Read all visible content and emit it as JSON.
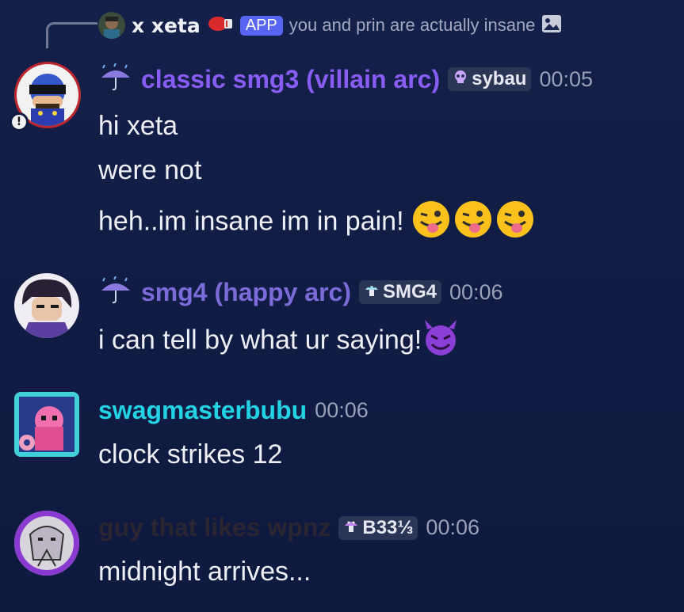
{
  "reply": {
    "name": "x xeta",
    "badge": "APP",
    "text": "you and prin are actually insane"
  },
  "messages": [
    {
      "username": "classic smg3 (villain arc)",
      "username_color": "#8a5cf6",
      "tag": "sybau",
      "time": "00:05",
      "lines": [
        "hi xeta",
        "were not",
        "heh..im insane im in pain!"
      ]
    },
    {
      "username": "smg4 (happy arc)",
      "username_color": "#7b6ad8",
      "tag": "SMG4",
      "time": "00:06",
      "lines": [
        "i can tell by what ur saying!"
      ]
    },
    {
      "username": "swagmasterbubu",
      "username_color": "#22d3e6",
      "time": "00:06",
      "lines": [
        "clock strikes 12"
      ]
    },
    {
      "username": "guy that likes wpnz",
      "username_color": "#2a2530",
      "tag": "B33⅓",
      "time": "00:06",
      "lines": [
        "midnight arrives..."
      ]
    }
  ],
  "icons": {
    "reply_attachment": "image-icon",
    "reply_emoji": "boxing-glove-icon",
    "role_icon": "umbrella-rain-icon",
    "tags": [
      "skull-icon",
      "mushroom-icon",
      "mushroom-icon"
    ],
    "emoji_tongue": "winking-tongue-emoji",
    "emoji_devil": "smiling-devil-emoji"
  }
}
